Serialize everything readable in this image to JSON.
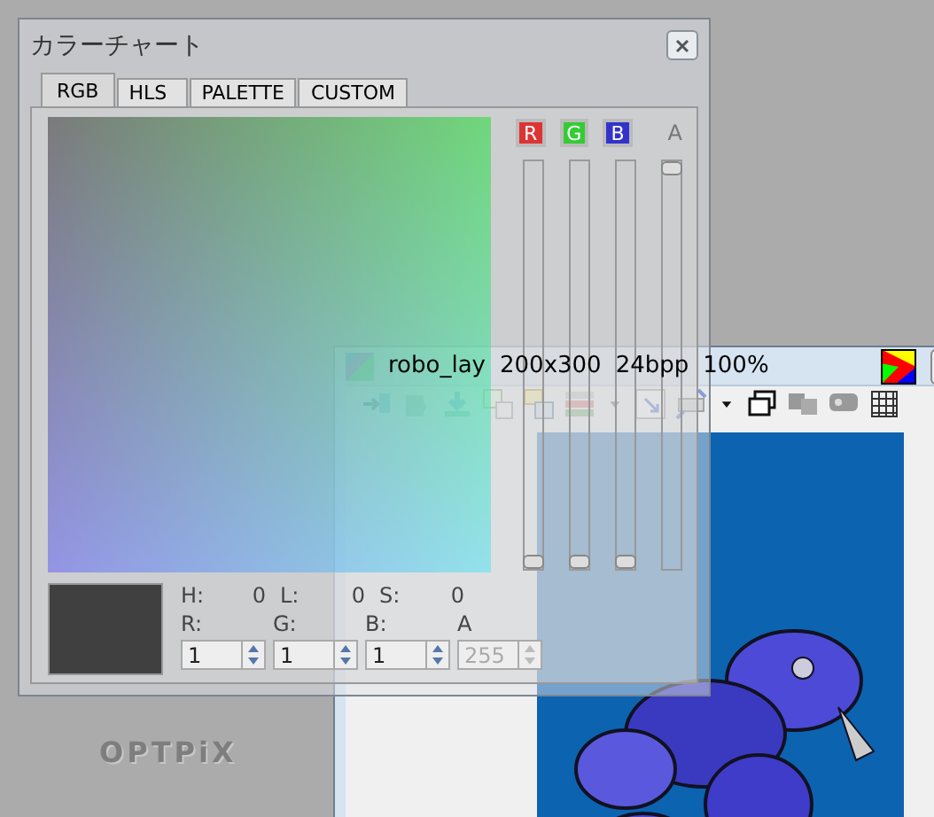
{
  "background_logo": {
    "brand": "OPTPiX"
  },
  "color_chart": {
    "title": "カラーチャート",
    "tabs": [
      {
        "label": "RGB",
        "selected": true
      },
      {
        "label": "HLS",
        "selected": false
      },
      {
        "label": "PALETTE",
        "selected": false
      },
      {
        "label": "CUSTOM",
        "selected": false
      }
    ],
    "channels": [
      {
        "label": "R",
        "color": "#dd3333",
        "level": 0
      },
      {
        "label": "G",
        "color": "#33cc33",
        "level": 0
      },
      {
        "label": "B",
        "color": "#3333cc",
        "level": 0
      },
      {
        "label": "A",
        "color": "#777777",
        "level": 1
      }
    ],
    "readout": [
      {
        "label": "H:",
        "value": "0"
      },
      {
        "label": "L:",
        "value": "0"
      },
      {
        "label": "S:",
        "value": "0"
      }
    ],
    "fields": [
      {
        "label": "R:",
        "value": "1",
        "disabled": false
      },
      {
        "label": "G:",
        "value": "1",
        "disabled": false
      },
      {
        "label": "B:",
        "value": "1",
        "disabled": false
      },
      {
        "label": "A",
        "value": "255",
        "disabled": true
      }
    ]
  },
  "image_window": {
    "name": "robo_lay",
    "size": "200x300",
    "depth": "24bpp",
    "zoom": "100%"
  }
}
